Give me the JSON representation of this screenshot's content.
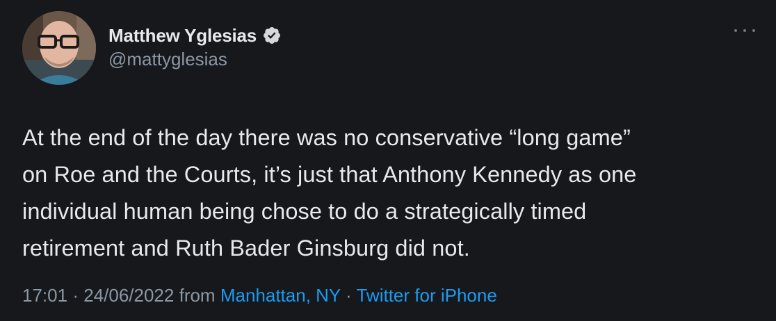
{
  "author": {
    "display_name": "Matthew Yglesias",
    "handle": "@mattyglesias",
    "verified": true
  },
  "tweet": {
    "lines": [
      "At the end of the day there was no conservative “long game”",
      "on Roe and the Courts, it’s just that Anthony Kennedy as one",
      "individual human being chose to do a strategically timed",
      "retirement and Ruth Bader Ginsburg did not."
    ]
  },
  "meta": {
    "time": "17:01",
    "separator": "·",
    "date": "24/06/2022",
    "from_label": "from",
    "location": "Manhattan, NY",
    "separator2": "·",
    "source": "Twitter for iPhone"
  },
  "colors": {
    "background": "#16181c",
    "text": "#e7e9ea",
    "secondary": "#8b98a5",
    "link": "#1d9bf0"
  },
  "icons": {
    "verified": "verified-badge-icon",
    "more": "more-options-icon"
  }
}
